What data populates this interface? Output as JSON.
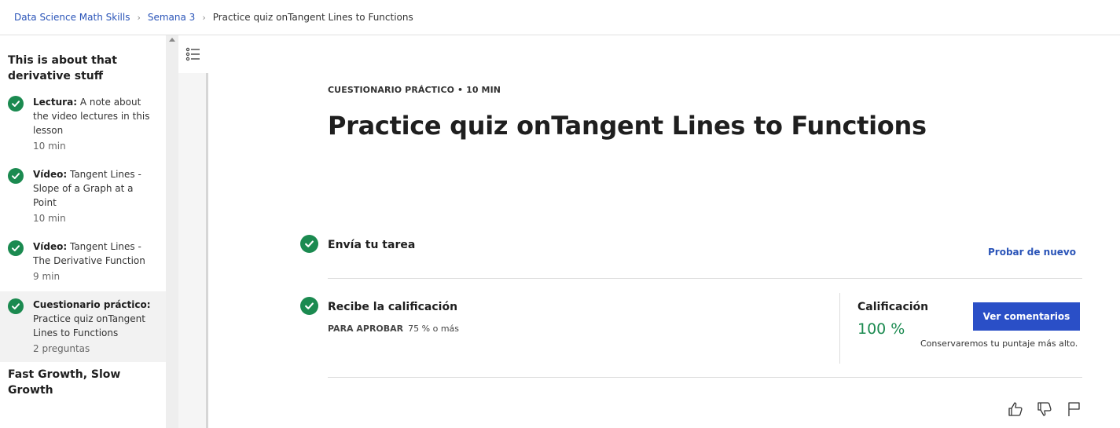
{
  "breadcrumb": {
    "items": [
      "Data Science Math Skills",
      "Semana 3"
    ],
    "current": "Practice quiz onTangent Lines to Functions"
  },
  "sidebar": {
    "section_title": "This is about that derivative stuff",
    "items": [
      {
        "type": "Lectura:",
        "title": " A note about the video lectures in this lesson",
        "meta": "10 min"
      },
      {
        "type": "Vídeo:",
        "title": " Tangent Lines - Slope of a Graph at a Point",
        "meta": "10 min"
      },
      {
        "type": "Vídeo:",
        "title": " Tangent Lines - The Derivative Function",
        "meta": "9 min"
      },
      {
        "type": "Cuestionario práctico:",
        "title": " Practice quiz onTangent Lines to Functions",
        "meta": "2 preguntas"
      }
    ],
    "next_section_title": "Fast Growth, Slow Growth"
  },
  "main": {
    "kicker": "CUESTIONARIO PRÁCTICO • 10 MIN",
    "title": "Practice quiz onTangent Lines to Functions",
    "submit": {
      "title": "Envía tu tarea",
      "retry_label": "Probar de nuevo"
    },
    "grade": {
      "title": "Recibe la calificación",
      "pass_label": "PARA APROBAR",
      "pass_value": "75 % o más",
      "grade_label": "Calificación",
      "grade_value": "100 %",
      "button_label": "Ver comentarios",
      "note": "Conservaremos tu puntaje más alto."
    }
  },
  "colors": {
    "accent": "#2a4fc7",
    "link": "#2a54b8",
    "success": "#1b8a50"
  },
  "icons": [
    "check-icon",
    "list-toc-icon",
    "thumbs-up-icon",
    "thumbs-down-icon",
    "flag-icon"
  ]
}
